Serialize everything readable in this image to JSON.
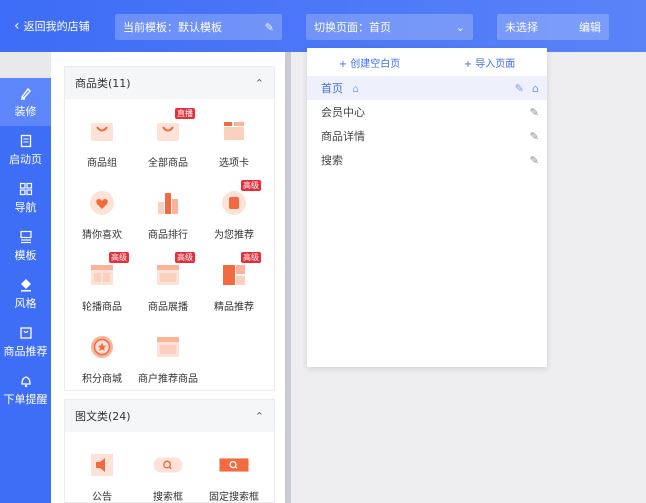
{
  "header": {
    "back_label": "返回我的店铺",
    "template_label": "当前模板：默认模板",
    "page_switch_label": "切换页面：首页",
    "selected_label": "未选择",
    "edit_label": "编辑"
  },
  "sidenav": {
    "items": [
      {
        "label": "装修",
        "icon": "brush-icon"
      },
      {
        "label": "启动页",
        "icon": "document-icon"
      },
      {
        "label": "导航",
        "icon": "grid-icon"
      },
      {
        "label": "模板",
        "icon": "template-icon"
      },
      {
        "label": "风格",
        "icon": "paint-bucket-icon"
      },
      {
        "label": "商品推荐",
        "icon": "bag-icon"
      },
      {
        "label": "下单提醒",
        "icon": "bell-icon"
      }
    ]
  },
  "groups": [
    {
      "title": "商品类(11)",
      "components": [
        {
          "label": "商品组",
          "badge": ""
        },
        {
          "label": "全部商品",
          "badge": "直播"
        },
        {
          "label": "选项卡",
          "badge": ""
        },
        {
          "label": "猜你喜欢",
          "badge": ""
        },
        {
          "label": "商品排行",
          "badge": ""
        },
        {
          "label": "为您推荐",
          "badge": "高级"
        },
        {
          "label": "轮播商品",
          "badge": "高级"
        },
        {
          "label": "商品展播",
          "badge": "高级"
        },
        {
          "label": "精品推荐",
          "badge": "高级"
        },
        {
          "label": "积分商城",
          "badge": ""
        },
        {
          "label": "商户推荐商品",
          "badge": ""
        }
      ]
    },
    {
      "title": "图文类(24)",
      "components": [
        {
          "label": "公告",
          "badge": ""
        },
        {
          "label": "搜索框",
          "badge": ""
        },
        {
          "label": "固定搜索框",
          "badge": ""
        }
      ]
    }
  ],
  "dropdown": {
    "create_label": "+ 创建空白页",
    "import_label": "+ 导入页面",
    "pages": [
      {
        "label": "首页",
        "active": true
      },
      {
        "label": "会员中心",
        "active": false
      },
      {
        "label": "商品详情",
        "active": false
      },
      {
        "label": "搜索",
        "active": false
      }
    ]
  },
  "colors": {
    "primary": "#3d6cf6",
    "accent": "#f26a3d",
    "badge": "#e5303b"
  }
}
